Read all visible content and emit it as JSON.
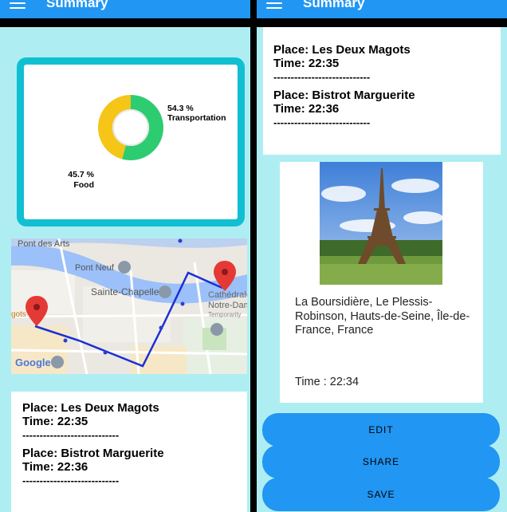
{
  "app_title": "Summary",
  "chart_data": {
    "type": "pie",
    "categories": [
      "Transportation",
      "Food"
    ],
    "values": [
      54.3,
      45.7
    ],
    "labels": [
      "54.3 %",
      "45.7 %"
    ],
    "colors": [
      "#2ecc71",
      "#f5c518"
    ]
  },
  "map": {
    "labels": [
      "Pont des Arts",
      "Pont Neuf",
      "Sainte-Chapelle",
      "Cathédrale",
      "Notre-Dam",
      "Temporarily",
      "Google",
      "gots"
    ]
  },
  "entries": [
    {
      "place": "Place: Les Deux Magots",
      "time": "Time: 22:35",
      "sep": "----------------------------"
    },
    {
      "place": "Place: Bistrot Marguerite",
      "time": "Time: 22:36",
      "sep": "----------------------------"
    }
  ],
  "photo_card": {
    "address": "La Boursidière, Le Plessis-Robinson, Hauts-de-Seine, Île-de-France, France",
    "time": "Time : 22:34"
  },
  "buttons": {
    "edit": "EDIT",
    "share": "SHARE",
    "save": "SAVE"
  },
  "colors": {
    "appbar": "#2196f3",
    "background": "#aeeef3",
    "card_border": "#11bfd3",
    "route": "#1a2fd8"
  }
}
